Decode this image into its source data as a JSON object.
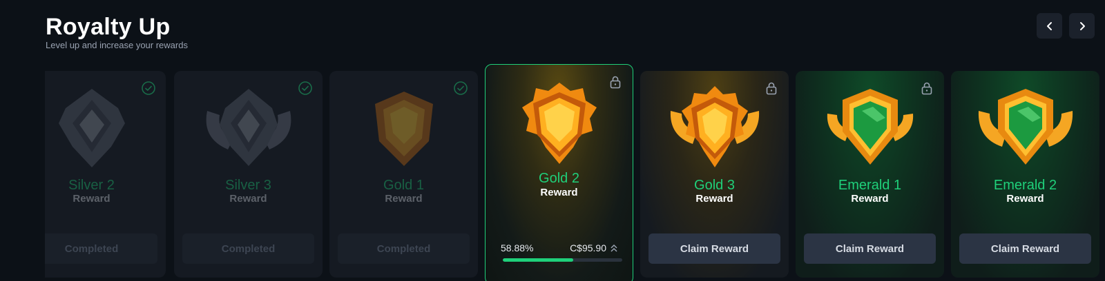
{
  "header": {
    "title": "Royalty Up",
    "subtitle": "Level up and increase your rewards"
  },
  "nav": {
    "prev_icon": "chevron-left-icon",
    "next_icon": "chevron-right-icon"
  },
  "tiers": [
    {
      "name": "Silver 2",
      "sub": "Reward",
      "state": "completed",
      "button": "Completed",
      "status_icon": "check-circle-icon"
    },
    {
      "name": "Silver 3",
      "sub": "Reward",
      "state": "completed",
      "button": "Completed",
      "status_icon": "check-circle-icon"
    },
    {
      "name": "Gold 1",
      "sub": "Reward",
      "state": "completed",
      "button": "Completed",
      "status_icon": "check-circle-icon"
    },
    {
      "name": "Gold 2",
      "sub": "Reward",
      "state": "current",
      "status_icon": "lock-icon",
      "progress_percent_label": "58.88%",
      "progress_amount": "C$95.90",
      "progress_fraction": 0.5888
    },
    {
      "name": "Gold 3",
      "sub": "Reward",
      "state": "locked",
      "button": "Claim Reward",
      "status_icon": "lock-icon"
    },
    {
      "name": "Emerald 1",
      "sub": "Reward",
      "state": "locked",
      "button": "Claim Reward",
      "status_icon": "lock-icon"
    },
    {
      "name": "Emerald 2",
      "sub": "Reward",
      "state": "locked",
      "button": "Claim Reward",
      "status_icon": "lock-icon"
    }
  ],
  "colors": {
    "accent": "#1fd07a",
    "background": "#0c1117",
    "gold": "#f5a623",
    "emerald": "#1faa4a"
  }
}
